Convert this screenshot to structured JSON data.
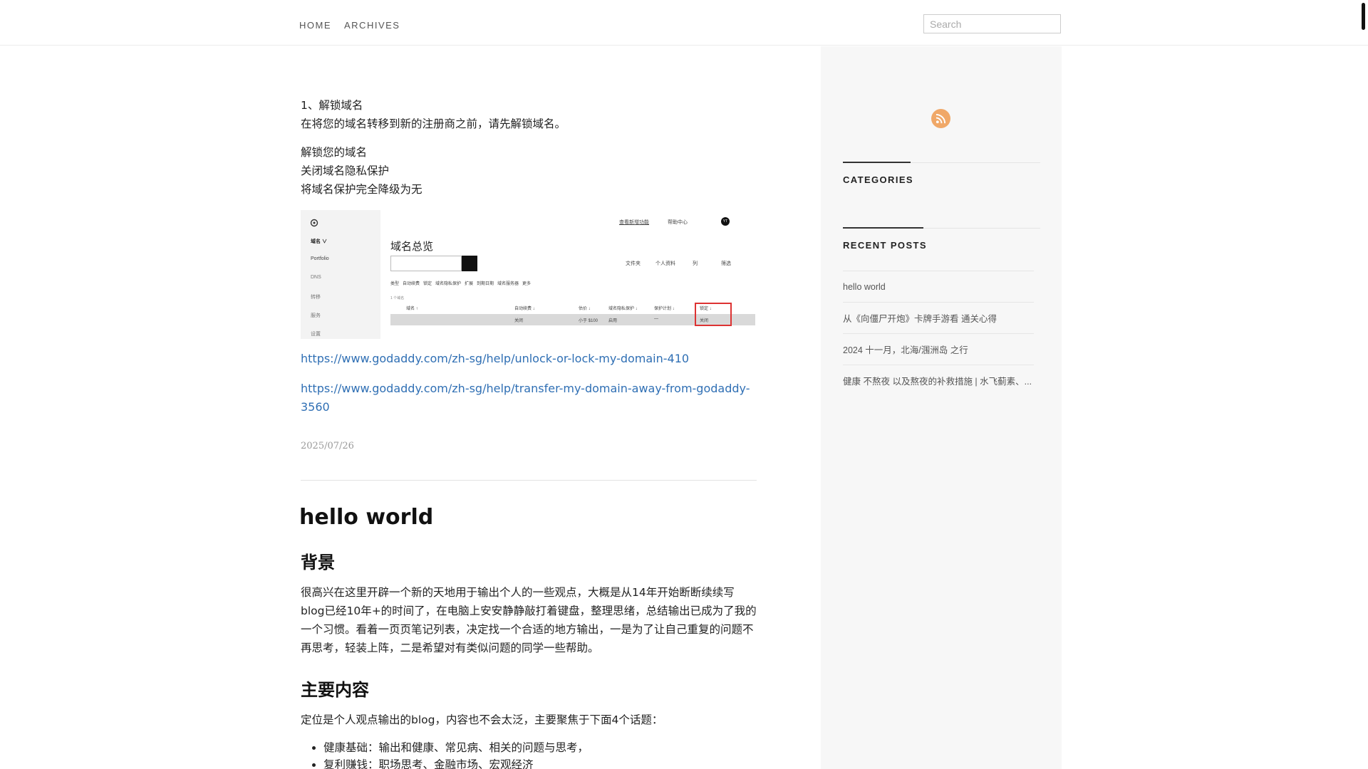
{
  "nav": {
    "home": "HOME",
    "archives": "ARCHIVES",
    "search_placeholder": "Search"
  },
  "sidebar": {
    "rss_icon": "rss-icon",
    "categories_title": "CATEGORIES",
    "recent_posts_title": "RECENT POSTS",
    "recent_posts": [
      "hello world",
      "从《向僵尸开炮》卡牌手游看 通关心得",
      "2024 十一月，北海/涠洲岛 之行",
      "健康 不熬夜 以及熬夜的补救措施 | 水飞蓟素、..."
    ]
  },
  "post1": {
    "line1": "1、解锁域名",
    "line2": "在将您的域名转移到新的注册商之前，请先解锁域名。",
    "step1": "解锁您的域名",
    "step2": "关闭域名隐私保护",
    "step3": "将域名保护完全降级为无",
    "screenshot": {
      "title": "域名总览",
      "menu_domain": "域名 ∨",
      "menu_portfolio": "Portfolio",
      "menu_dns": "DNS",
      "menu_transfer": "转移",
      "menu_service": "服务",
      "menu_settings": "设置",
      "top_link": "查看新增功能",
      "help": "帮助中心",
      "avatar": "YT",
      "folder": "文件夹",
      "profile": "个人资料",
      "list": "列",
      "filter": "筛选",
      "filters": "类型   自动续费   锁定   域名隐私保护   扩展   到期日期   域名服务器   更多",
      "count": "1 个域名",
      "col_name": "域名 ↑",
      "col_renew": "自动续费 ↓",
      "col_value": "估价 ↓",
      "col_privacy": "域名隐私保护 ↓",
      "col_plan": "保护计划 ↓",
      "col_lock": "锁定 ↓",
      "row_renew": "关闭",
      "row_value": "小于 $100",
      "row_privacy": "启用",
      "row_plan": "—",
      "row_lock": "关闭"
    },
    "link1": "https://www.godaddy.com/zh-sg/help/unlock-or-lock-my-domain-410",
    "link2": "https://www.godaddy.com/zh-sg/help/transfer-my-domain-away-from-godaddy-3560",
    "date": "2025/07/26"
  },
  "post2": {
    "title": "hello world",
    "h_background": "背景",
    "background_text": "很高兴在这里开辟一个新的天地用于输出个人的一些观点，大概是从14年开始断断续续写blog已经10年+的时间了，在电脑上安安静静敲打着键盘，整理思绪，总结输出已成为了我的一个习惯。看着一页页笔记列表，决定找一个合适的地方输出，一是为了让自己重复的问题不再思考，轻装上阵，二是希望对有类似问题的同学一些帮助。",
    "h_main": "主要内容",
    "main_text": "定位是个人观点输出的blog，内容也不会太泛，主要聚焦于下面4个话题：",
    "topics": [
      "健康基础：输出和健康、常见病、相关的问题与思考，",
      "复利赚钱：职场思考、金融市场、宏观经济"
    ]
  }
}
